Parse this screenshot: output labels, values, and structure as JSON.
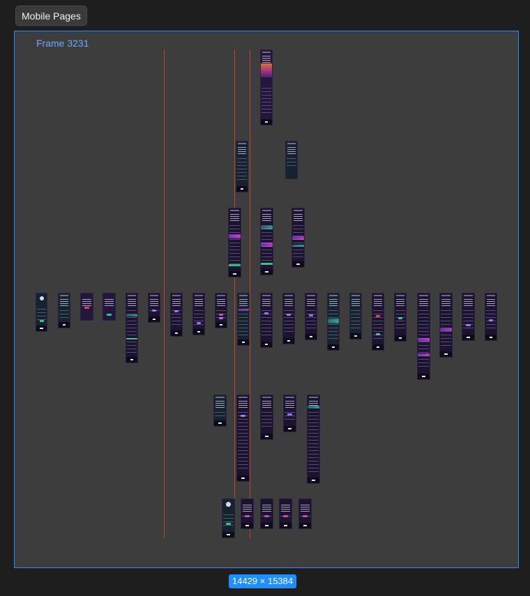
{
  "page_tab": {
    "label": "Mobile Pages"
  },
  "frame": {
    "label": "Frame 3231"
  },
  "selection_size": {
    "label": "14429 × 15384"
  },
  "colors": {
    "canvas": "#1e1e1e",
    "frame_fill": "#3d3d3d",
    "selection_blue": "#1e8fff",
    "frame_label": "#6fa8ff",
    "guide": "#c0452b",
    "screen_fill": "#1b1330"
  }
}
